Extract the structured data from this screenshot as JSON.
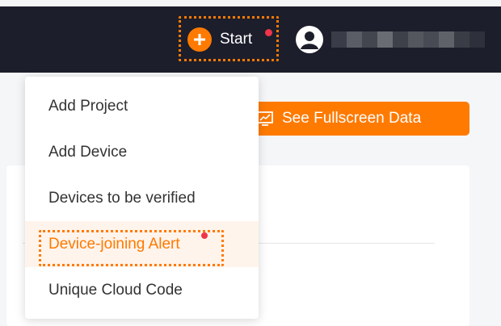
{
  "header": {
    "start_label": "Start",
    "start_has_badge": true,
    "colors": {
      "bar": "#1c1e2b",
      "accent": "#ff7a00",
      "badge": "#f0344a"
    }
  },
  "main": {
    "fullscreen_label": "See Fullscreen Data"
  },
  "dropdown": {
    "items": [
      {
        "label": "Add Project",
        "highlighted": false
      },
      {
        "label": "Add Device",
        "highlighted": false
      },
      {
        "label": "Devices to be verified",
        "highlighted": false
      },
      {
        "label": "Device-joining Alert",
        "highlighted": true,
        "has_badge": true
      },
      {
        "label": "Unique Cloud Code",
        "highlighted": false
      }
    ]
  },
  "icons": [
    "plus-icon",
    "avatar-icon",
    "screen-icon"
  ]
}
